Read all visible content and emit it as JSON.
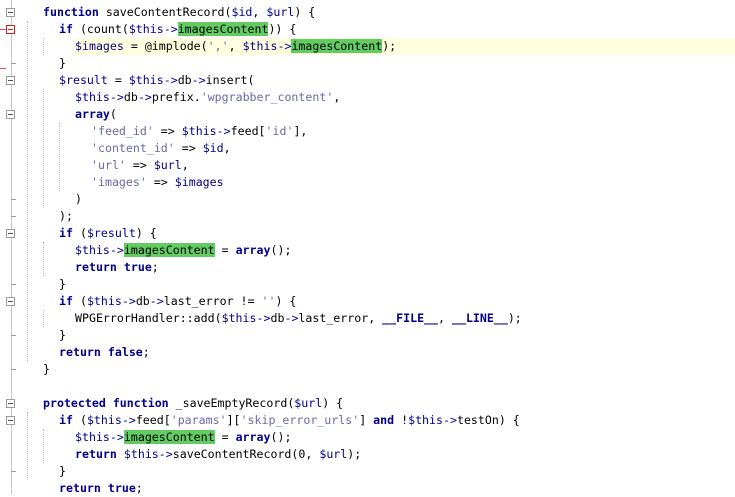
{
  "editor": {
    "lines": [
      [
        {
          "t": "function",
          "c": "kw"
        },
        {
          "t": " saveContentRecord(",
          "c": "fn"
        },
        {
          "t": "$id",
          "c": "var"
        },
        {
          "t": ", ",
          "c": "fn"
        },
        {
          "t": "$url",
          "c": "var"
        },
        {
          "t": ") {",
          "c": "fn"
        }
      ],
      [
        {
          "t": "if",
          "c": "kw"
        },
        {
          "t": " (count(",
          "c": "fn"
        },
        {
          "t": "$this",
          "c": "var"
        },
        {
          "t": "->",
          "c": "op"
        },
        {
          "t": "imagesContent",
          "c": "hl"
        },
        {
          "t": ")) {",
          "c": "fn"
        }
      ],
      [
        {
          "t": "$images",
          "c": "var"
        },
        {
          "t": " = @implode(",
          "c": "fn"
        },
        {
          "t": "','",
          "c": "str"
        },
        {
          "t": ", ",
          "c": "fn"
        },
        {
          "t": "$this",
          "c": "var"
        },
        {
          "t": "->",
          "c": "op"
        },
        {
          "t": "imagesContent",
          "c": "hl"
        },
        {
          "t": ");",
          "c": "fn"
        }
      ],
      [
        {
          "t": "}",
          "c": "fn"
        }
      ],
      [
        {
          "t": "$result",
          "c": "var"
        },
        {
          "t": " = ",
          "c": "fn"
        },
        {
          "t": "$this",
          "c": "var"
        },
        {
          "t": "->",
          "c": "op"
        },
        {
          "t": "db",
          "c": "fn"
        },
        {
          "t": "->",
          "c": "op"
        },
        {
          "t": "insert(",
          "c": "fn"
        }
      ],
      [
        {
          "t": "$this",
          "c": "var"
        },
        {
          "t": "->",
          "c": "op"
        },
        {
          "t": "db",
          "c": "fn"
        },
        {
          "t": "->",
          "c": "op"
        },
        {
          "t": "prefix.",
          "c": "fn"
        },
        {
          "t": "'wpgrabber_content'",
          "c": "str"
        },
        {
          "t": ",",
          "c": "fn"
        }
      ],
      [
        {
          "t": "array",
          "c": "kw"
        },
        {
          "t": "(",
          "c": "fn"
        }
      ],
      [
        {
          "t": "'feed_id'",
          "c": "str"
        },
        {
          "t": " => ",
          "c": "fn"
        },
        {
          "t": "$this",
          "c": "var"
        },
        {
          "t": "->",
          "c": "op"
        },
        {
          "t": "feed[",
          "c": "fn"
        },
        {
          "t": "'id'",
          "c": "str"
        },
        {
          "t": "],",
          "c": "fn"
        }
      ],
      [
        {
          "t": "'content_id'",
          "c": "str"
        },
        {
          "t": " => ",
          "c": "fn"
        },
        {
          "t": "$id",
          "c": "var"
        },
        {
          "t": ",",
          "c": "fn"
        }
      ],
      [
        {
          "t": "'url'",
          "c": "str"
        },
        {
          "t": " => ",
          "c": "fn"
        },
        {
          "t": "$url",
          "c": "var"
        },
        {
          "t": ",",
          "c": "fn"
        }
      ],
      [
        {
          "t": "'images'",
          "c": "str"
        },
        {
          "t": " => ",
          "c": "fn"
        },
        {
          "t": "$images",
          "c": "var"
        }
      ],
      [
        {
          "t": ")",
          "c": "fn"
        }
      ],
      [
        {
          "t": ");",
          "c": "fn"
        }
      ],
      [
        {
          "t": "if",
          "c": "kw"
        },
        {
          "t": " (",
          "c": "fn"
        },
        {
          "t": "$result",
          "c": "var"
        },
        {
          "t": ") {",
          "c": "fn"
        }
      ],
      [
        {
          "t": "$this",
          "c": "var"
        },
        {
          "t": "->",
          "c": "op"
        },
        {
          "t": "imagesContent",
          "c": "hl"
        },
        {
          "t": " = ",
          "c": "fn"
        },
        {
          "t": "array",
          "c": "kw"
        },
        {
          "t": "();",
          "c": "fn"
        }
      ],
      [
        {
          "t": "return",
          "c": "kw"
        },
        {
          "t": " ",
          "c": "fn"
        },
        {
          "t": "true",
          "c": "kw"
        },
        {
          "t": ";",
          "c": "fn"
        }
      ],
      [
        {
          "t": "}",
          "c": "fn"
        }
      ],
      [
        {
          "t": "if",
          "c": "kw"
        },
        {
          "t": " (",
          "c": "fn"
        },
        {
          "t": "$this",
          "c": "var"
        },
        {
          "t": "->",
          "c": "op"
        },
        {
          "t": "db",
          "c": "fn"
        },
        {
          "t": "->",
          "c": "op"
        },
        {
          "t": "last_error != ",
          "c": "fn"
        },
        {
          "t": "''",
          "c": "str"
        },
        {
          "t": ") {",
          "c": "fn"
        }
      ],
      [
        {
          "t": "WPGErrorHandler::add(",
          "c": "fn"
        },
        {
          "t": "$this",
          "c": "var"
        },
        {
          "t": "->",
          "c": "op"
        },
        {
          "t": "db",
          "c": "fn"
        },
        {
          "t": "->",
          "c": "op"
        },
        {
          "t": "last_error, ",
          "c": "fn"
        },
        {
          "t": "__FILE__",
          "c": "kw"
        },
        {
          "t": ", ",
          "c": "fn"
        },
        {
          "t": "__LINE__",
          "c": "kw"
        },
        {
          "t": ");",
          "c": "fn"
        }
      ],
      [
        {
          "t": "}",
          "c": "fn"
        }
      ],
      [
        {
          "t": "return",
          "c": "kw"
        },
        {
          "t": " ",
          "c": "fn"
        },
        {
          "t": "false",
          "c": "kw"
        },
        {
          "t": ";",
          "c": "fn"
        }
      ],
      [
        {
          "t": "}",
          "c": "fn"
        }
      ],
      [],
      [
        {
          "t": "protected",
          "c": "kw"
        },
        {
          "t": " ",
          "c": "fn"
        },
        {
          "t": "function",
          "c": "kw"
        },
        {
          "t": " _saveEmptyRecord(",
          "c": "fn"
        },
        {
          "t": "$url",
          "c": "var"
        },
        {
          "t": ") {",
          "c": "fn"
        }
      ],
      [
        {
          "t": "if",
          "c": "kw"
        },
        {
          "t": " (",
          "c": "fn"
        },
        {
          "t": "$this",
          "c": "var"
        },
        {
          "t": "->",
          "c": "op"
        },
        {
          "t": "feed[",
          "c": "fn"
        },
        {
          "t": "'params'",
          "c": "str"
        },
        {
          "t": "][",
          "c": "fn"
        },
        {
          "t": "'skip_error_urls'",
          "c": "str"
        },
        {
          "t": "] ",
          "c": "fn"
        },
        {
          "t": "and",
          "c": "kw"
        },
        {
          "t": " !",
          "c": "fn"
        },
        {
          "t": "$this",
          "c": "var"
        },
        {
          "t": "->",
          "c": "op"
        },
        {
          "t": "testOn) {",
          "c": "fn"
        }
      ],
      [
        {
          "t": "$this",
          "c": "var"
        },
        {
          "t": "->",
          "c": "op"
        },
        {
          "t": "imagesContent",
          "c": "hl"
        },
        {
          "t": " = ",
          "c": "fn"
        },
        {
          "t": "array",
          "c": "kw"
        },
        {
          "t": "();",
          "c": "fn"
        }
      ],
      [
        {
          "t": "return",
          "c": "kw"
        },
        {
          "t": " ",
          "c": "fn"
        },
        {
          "t": "$this",
          "c": "var"
        },
        {
          "t": "->",
          "c": "op"
        },
        {
          "t": "saveContentRecord(0, ",
          "c": "fn"
        },
        {
          "t": "$url",
          "c": "var"
        },
        {
          "t": ");",
          "c": "fn"
        }
      ],
      [
        {
          "t": "}",
          "c": "fn"
        }
      ],
      [
        {
          "t": "return",
          "c": "kw"
        },
        {
          "t": " ",
          "c": "fn"
        },
        {
          "t": "true",
          "c": "kw"
        },
        {
          "t": ";",
          "c": "fn"
        }
      ]
    ]
  }
}
